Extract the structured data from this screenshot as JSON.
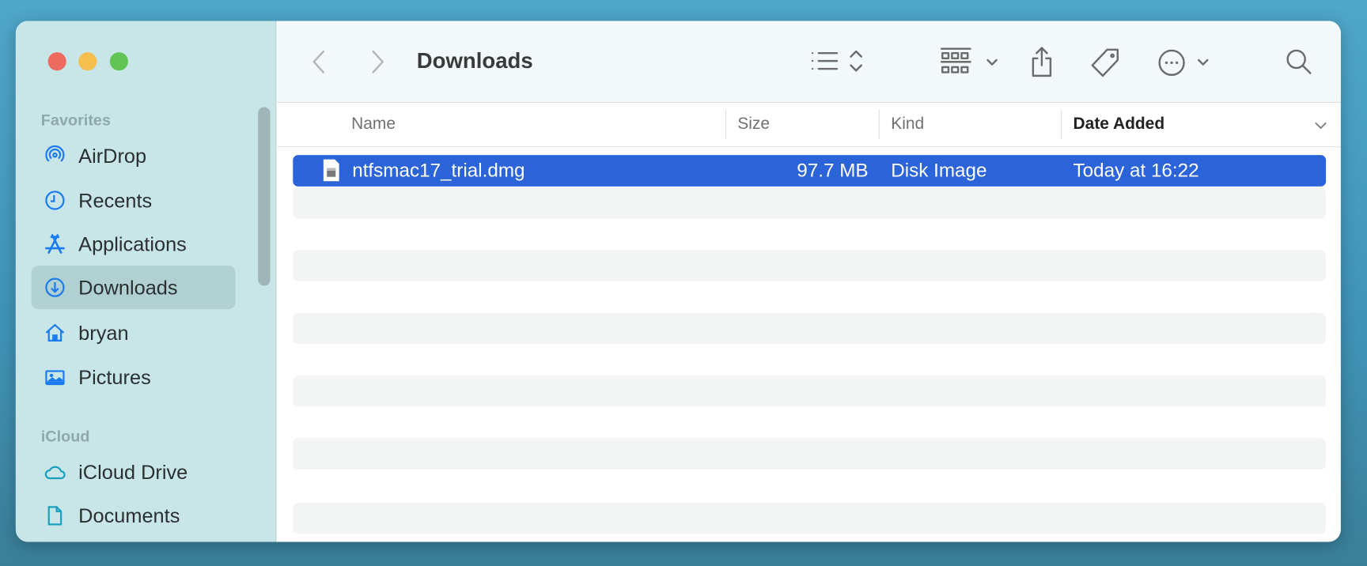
{
  "window": {
    "title": "Downloads"
  },
  "sidebar": {
    "sections": [
      {
        "label": "Favorites",
        "items": [
          {
            "label": "AirDrop",
            "icon": "airdrop-icon"
          },
          {
            "label": "Recents",
            "icon": "clock-icon"
          },
          {
            "label": "Applications",
            "icon": "applications-icon"
          },
          {
            "label": "Downloads",
            "icon": "download-icon",
            "selected": true
          },
          {
            "label": "bryan",
            "icon": "home-icon"
          },
          {
            "label": "Pictures",
            "icon": "photo-icon"
          }
        ]
      },
      {
        "label": "iCloud",
        "items": [
          {
            "label": "iCloud Drive",
            "icon": "cloud-icon"
          },
          {
            "label": "Documents",
            "icon": "document-icon"
          }
        ]
      }
    ]
  },
  "columns": {
    "name": "Name",
    "size": "Size",
    "kind": "Kind",
    "date": "Date Added"
  },
  "files": [
    {
      "name": "ntfsmac17_trial.dmg",
      "size": "97.7 MB",
      "kind": "Disk Image",
      "date": "Today at 16:22",
      "selected": true
    }
  ],
  "colors": {
    "accent": "#2b63d9",
    "sidebar": "#c8e5e7",
    "icon_blue": "#1a7cf0"
  }
}
